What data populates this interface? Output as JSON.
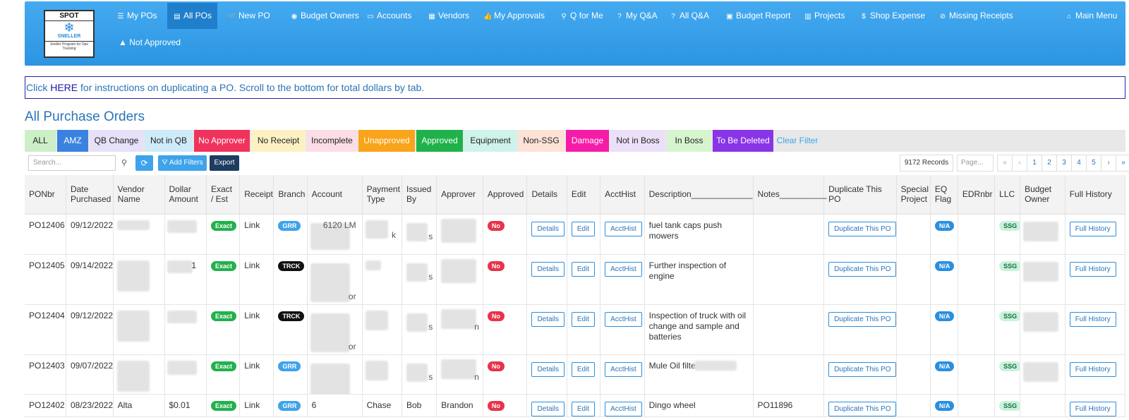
{
  "logo": {
    "title": "SPOT",
    "line1": "SNELLER",
    "line2": "Sneller Program for",
    "line3": "Ops Tracking"
  },
  "nav": [
    {
      "label": "My POs",
      "icon": "list-icon"
    },
    {
      "label": "All POs",
      "icon": "grid-icon",
      "active": true
    },
    {
      "label": "New PO",
      "icon": "cart-icon"
    },
    {
      "label": "Budget Owners",
      "icon": "user-circle-icon"
    },
    {
      "label": "Accounts",
      "icon": "card-icon"
    },
    {
      "label": "Vendors",
      "icon": "building-icon"
    },
    {
      "label": "My Approvals",
      "icon": "thumbs-up-icon"
    },
    {
      "label": "Q for Me",
      "icon": "map-pin-icon"
    },
    {
      "label": "My Q&A",
      "icon": "question-icon"
    },
    {
      "label": "All Q&A",
      "icon": "question-icon"
    },
    {
      "label": "Budget Report",
      "icon": "report-icon"
    },
    {
      "label": "Projects",
      "icon": "project-icon"
    },
    {
      "label": "Shop Expense",
      "icon": "dollar-icon"
    },
    {
      "label": "Missing Receipts",
      "icon": "ban-icon"
    },
    {
      "label": "Main Menu",
      "icon": "home-icon"
    }
  ],
  "nav_row2": {
    "label": "Not Approved",
    "icon": "warning-icon"
  },
  "info": {
    "prefix": "Click ",
    "link": "HERE",
    "suffix": " for instructions on duplicating a PO. Scroll to the bottom for total dollars by tab."
  },
  "page_title": "All Purchase Orders",
  "tabs": [
    {
      "label": "ALL",
      "bg": "#cdefc8",
      "fg": "#222"
    },
    {
      "label": "AMZ",
      "bg": "#3b82e0",
      "fg": "#ffffff"
    },
    {
      "label": "QB Change",
      "bg": "#e6e0f8",
      "fg": "#222"
    },
    {
      "label": "Not in QB",
      "bg": "#cfeaf8",
      "fg": "#222"
    },
    {
      "label": "No Approver",
      "bg": "#f0335c",
      "fg": "#ffffff"
    },
    {
      "label": "No Receipt",
      "bg": "#fdf1c4",
      "fg": "#222"
    },
    {
      "label": "Incomplete",
      "bg": "#fcdde6",
      "fg": "#222"
    },
    {
      "label": "Unapproved",
      "bg": "#f9a41a",
      "fg": "#ffffff"
    },
    {
      "label": "Approved",
      "bg": "#1fb24a",
      "fg": "#ffffff"
    },
    {
      "label": "Equipment",
      "bg": "#cff3ea",
      "fg": "#222"
    },
    {
      "label": "Non-SSG",
      "bg": "#fde3d6",
      "fg": "#222"
    },
    {
      "label": "Damage",
      "bg": "#f51ca8",
      "fg": "#ffffff"
    },
    {
      "label": "Not in Boss",
      "bg": "#ece0f8",
      "fg": "#222"
    },
    {
      "label": "In Boss",
      "bg": "#d6f5cf",
      "fg": "#222"
    },
    {
      "label": "To Be Deleted",
      "bg": "#8a34e8",
      "fg": "#ffffff"
    },
    {
      "label": "Clear Filter",
      "bg": "transparent",
      "fg": "#3ea3ea"
    }
  ],
  "toolbar": {
    "search_placeholder": "Search...",
    "add_filters": "Add Filters",
    "export": "Export",
    "records": "9172 Records",
    "page_placeholder": "Page..."
  },
  "pager": [
    "«",
    "‹",
    "1",
    "2",
    "3",
    "4",
    "5",
    "›",
    "»"
  ],
  "columns": [
    "PONbr",
    "Date Purchased",
    "Vendor Name",
    "Dollar Amount",
    "Exact / Est",
    "Receipt",
    "Branch",
    "Account",
    "Payment Type",
    "Issued By",
    "Approver",
    "Approved",
    "Details",
    "Edit",
    "AcctHist",
    "Description_____________",
    "Notes__________",
    "Duplicate This PO",
    "Special Project",
    "EQ Flag",
    "EDRnbr",
    "LLC",
    "Budget Owner",
    "Full History"
  ],
  "rows": [
    {
      "po": "PO12406",
      "date": "09/12/2022",
      "amount": "",
      "exact": "Exact",
      "receipt": "Link",
      "branch": "GRR",
      "account": "6120 LM",
      "payment": "k",
      "issued": "s",
      "approver": "",
      "approved": "No",
      "description": "fuel tank caps push mowers",
      "notes": "",
      "eq": "N/A",
      "llc": "SSG"
    },
    {
      "po": "PO12405",
      "date": "09/14/2022",
      "amount": "1",
      "exact": "Exact",
      "receipt": "Link",
      "branch": "TRCK",
      "account": "or",
      "payment": "",
      "issued": "s",
      "approver": "",
      "approved": "No",
      "description": "Further inspection of engine",
      "notes": "",
      "eq": "N/A",
      "llc": "SSG"
    },
    {
      "po": "PO12404",
      "date": "09/12/2022",
      "amount": "",
      "exact": "Exact",
      "receipt": "Link",
      "branch": "TRCK",
      "account": "or",
      "payment": "",
      "issued": "s",
      "approver": "n",
      "approved": "No",
      "description": "Inspection of truck with oil change and sample and batteries",
      "notes": "",
      "eq": "N/A",
      "llc": "SSG"
    },
    {
      "po": "PO12403",
      "date": "09/07/2022",
      "amount": "",
      "exact": "Exact",
      "receipt": "Link",
      "branch": "GRR",
      "account": "",
      "payment": "",
      "issued": "s",
      "approver": "n",
      "approved": "No",
      "description": "Mule Oil filters",
      "notes": "",
      "eq": "N/A",
      "llc": "SSG"
    },
    {
      "po": "PO12402",
      "date": "08/23/2022",
      "vendor": "Alta",
      "amount": "$0.01",
      "exact": "Exact",
      "receipt": "Link",
      "branch": "GRR",
      "account": "6",
      "payment": "Chase",
      "issued": "Bob",
      "approver": "Brandon",
      "approved": "No",
      "description": "Dingo wheel",
      "notes": "PO11896",
      "eq": "N/A",
      "llc": "SSG"
    }
  ],
  "buttons": {
    "details": "Details",
    "edit": "Edit",
    "accthist": "AcctHist",
    "duplicate": "Duplicate This PO",
    "full_history": "Full History"
  }
}
